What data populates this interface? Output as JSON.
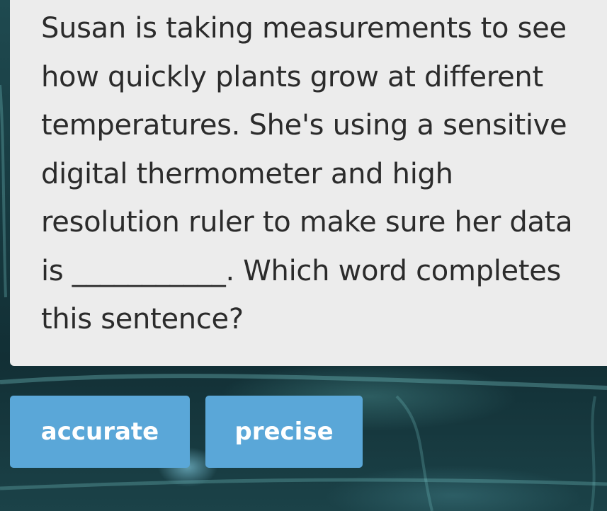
{
  "question": {
    "text": "Susan is taking measurements to see how quickly plants grow at different temperatures. She's using a sensitive digital thermometer and high resolution ruler to make sure her data is ___________. Which word completes this sentence?"
  },
  "answers": [
    {
      "label": "accurate"
    },
    {
      "label": "precise"
    }
  ],
  "colors": {
    "card_background": "#ececec",
    "button_background": "#5aa7d8",
    "button_text": "#ffffff",
    "page_background": "#173a40"
  }
}
